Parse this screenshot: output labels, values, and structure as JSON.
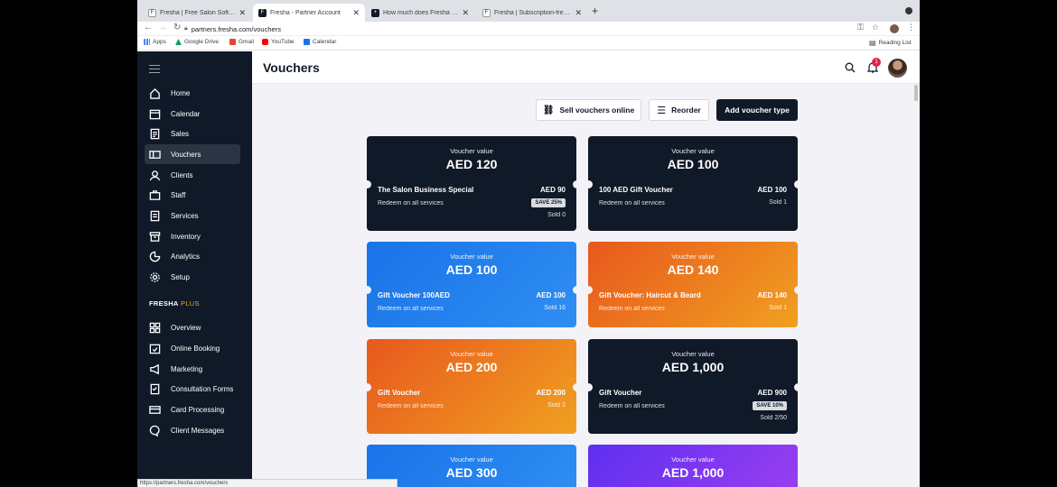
{
  "browser": {
    "tabs": [
      {
        "title": "Fresha | Free Salon Software | ",
        "active": false
      },
      {
        "title": "Fresha - Partner Account",
        "active": true
      },
      {
        "title": "How much does Fresha Plus co",
        "active": false
      },
      {
        "title": "Fresha | Subscription-free Salo",
        "active": false
      }
    ],
    "url": "partners.fresha.com/vouchers",
    "bookmarks": [
      {
        "label": "Apps",
        "icon": "apps-grid-icon",
        "color": "#4285f4"
      },
      {
        "label": "Google Drive",
        "icon": "google-drive-icon",
        "color": "#0f9d58"
      },
      {
        "label": "Gmail",
        "icon": "gmail-icon",
        "color": "#ea4335"
      },
      {
        "label": "YouTube",
        "icon": "youtube-icon",
        "color": "#ff0000"
      },
      {
        "label": "Calendar",
        "icon": "calendar-icon",
        "color": "#1a73e8"
      }
    ],
    "reading_list": "Reading List",
    "status_url": "https://partners.fresha.com/vouchers"
  },
  "sidebar": {
    "items": [
      {
        "label": "Home",
        "icon": "home-icon"
      },
      {
        "label": "Calendar",
        "icon": "calendar-icon"
      },
      {
        "label": "Sales",
        "icon": "sales-icon"
      },
      {
        "label": "Vouchers",
        "icon": "voucher-icon",
        "active": true
      },
      {
        "label": "Clients",
        "icon": "clients-icon"
      },
      {
        "label": "Staff",
        "icon": "staff-icon"
      },
      {
        "label": "Services",
        "icon": "services-icon"
      },
      {
        "label": "Inventory",
        "icon": "inventory-icon"
      },
      {
        "label": "Analytics",
        "icon": "analytics-icon"
      },
      {
        "label": "Setup",
        "icon": "gear-icon"
      }
    ],
    "plus_title": "FRESHA",
    "plus_title_accent": "PLUS",
    "plus_items": [
      {
        "label": "Overview",
        "icon": "grid-icon"
      },
      {
        "label": "Online Booking",
        "icon": "online-booking-icon"
      },
      {
        "label": "Marketing",
        "icon": "megaphone-icon"
      },
      {
        "label": "Consultation Forms",
        "icon": "form-icon"
      },
      {
        "label": "Card Processing",
        "icon": "card-icon"
      },
      {
        "label": "Client Messages",
        "icon": "message-icon"
      }
    ]
  },
  "header": {
    "title": "Vouchers",
    "notification_count": "1"
  },
  "toolbar": {
    "sell_online": "Sell vouchers online",
    "reorder": "Reorder",
    "add_type": "Add voucher type"
  },
  "vouchers": [
    {
      "label": "Voucher value",
      "value": "AED 120",
      "name": "The Salon Business Special",
      "price": "AED 90",
      "redeem": "Redeem on all services",
      "save": "SAVE 25%",
      "sold": "Sold 0",
      "theme": "dark"
    },
    {
      "label": "Voucher value",
      "value": "AED 100",
      "name": "100 AED Gift Voucher",
      "price": "AED 100",
      "redeem": "Redeem on all services",
      "save": "",
      "sold": "Sold 1",
      "theme": "dark"
    },
    {
      "label": "Voucher value",
      "value": "AED 100",
      "name": "Gift Voucher 100AED",
      "price": "AED 100",
      "redeem": "Redeem on all services",
      "save": "",
      "sold": "Sold 16",
      "theme": "blue"
    },
    {
      "label": "Voucher value",
      "value": "AED 140",
      "name": "Gift Voucher: Haircut & Beard",
      "price": "AED 140",
      "redeem": "Redeem on all services",
      "save": "",
      "sold": "Sold 1",
      "theme": "orange"
    },
    {
      "label": "Voucher value",
      "value": "AED 200",
      "name": "Gift Voucher",
      "price": "AED 200",
      "redeem": "Redeem on all services",
      "save": "",
      "sold": "Sold 2",
      "theme": "orange"
    },
    {
      "label": "Voucher value",
      "value": "AED 1,000",
      "name": "Gift Voucher",
      "price": "AED 900",
      "redeem": "Redeem on all services",
      "save": "SAVE 10%",
      "sold": "Sold 2/50",
      "theme": "dark"
    },
    {
      "label": "Voucher value",
      "value": "AED 300",
      "name": "",
      "price": "",
      "redeem": "",
      "save": "",
      "sold": "",
      "theme": "blue"
    },
    {
      "label": "Voucher value",
      "value": "AED 1,000",
      "name": "",
      "price": "",
      "redeem": "",
      "save": "",
      "sold": "",
      "theme": "purple"
    }
  ]
}
